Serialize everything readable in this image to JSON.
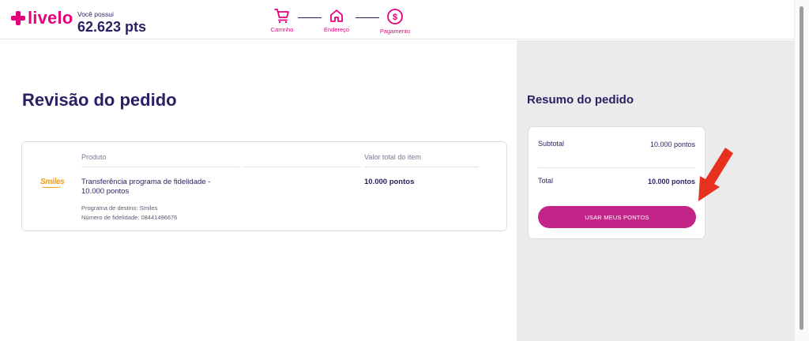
{
  "header": {
    "brand": "livelo",
    "points_label": "Você possui",
    "points_value": "62.623 pts"
  },
  "steps": [
    {
      "label": "Carrinho",
      "icon": "cart-icon"
    },
    {
      "label": "Endereço",
      "icon": "home-icon"
    },
    {
      "label": "Pagamento",
      "icon": "dollar-icon"
    }
  ],
  "main": {
    "title": "Revisão do pedido",
    "columns": {
      "product": "Produto",
      "value": "Valor total do item"
    },
    "item": {
      "partner_logo": "Smiles",
      "name": "Transferência programa de fidelidade - 10.000 pontos",
      "destination": "Programa de destino: Smiles",
      "loyalty_number": "Número de fidelidade: 08441496676",
      "price": "10.000 pontos"
    }
  },
  "summary": {
    "title": "Resumo do pedido",
    "subtotal_label": "Subtotal",
    "subtotal_value": "10.000 pontos",
    "total_label": "Total",
    "total_value": "10.000 pontos",
    "button_label": "USAR MEUS PONTOS"
  },
  "colors": {
    "brand_pink": "#e6007e",
    "button": "#c32488",
    "navy": "#2a1f63",
    "arrow": "#e8301e"
  }
}
